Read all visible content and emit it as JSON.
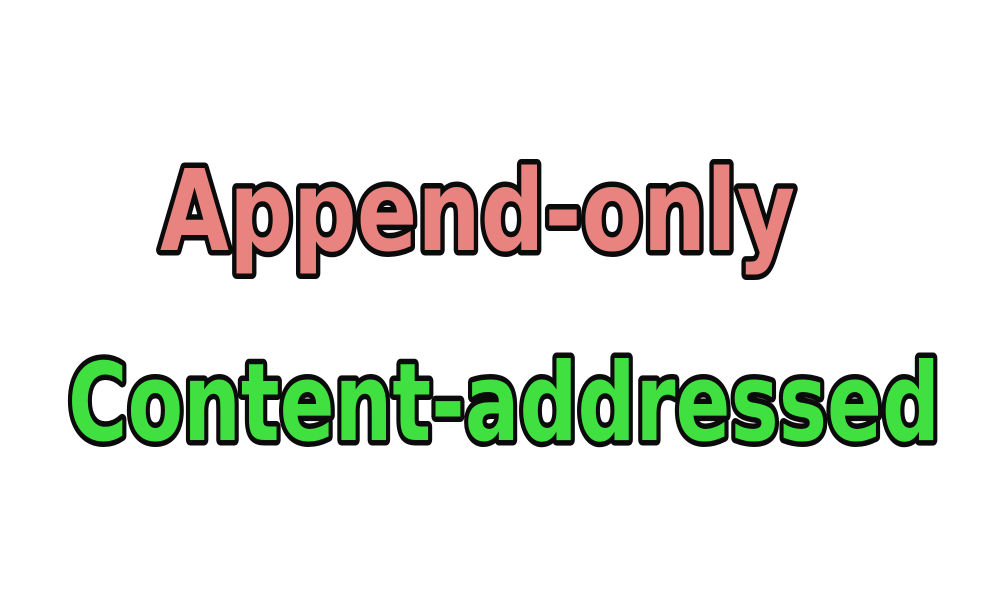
{
  "lines": [
    {
      "text": "Append-only",
      "color": "#e8837f"
    },
    {
      "text": "Content-addressed",
      "color": "#3fe03f"
    }
  ],
  "outline_color": "#0b0b0b",
  "background": "#ffffff"
}
